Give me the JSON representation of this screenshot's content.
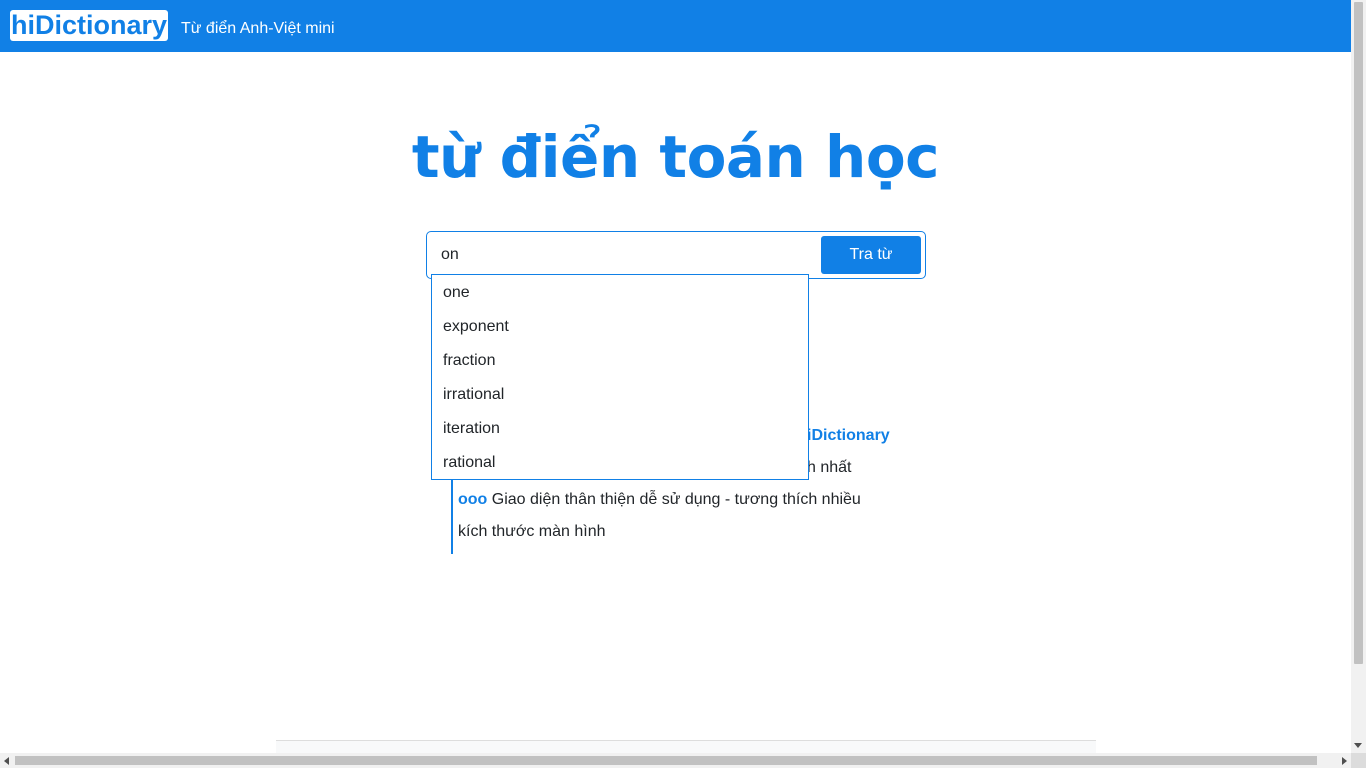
{
  "header": {
    "brand": "hiDictionary",
    "tagline": "Từ điển Anh-Việt mini"
  },
  "main": {
    "title": "từ điển toán học"
  },
  "search": {
    "value": "on",
    "button_label": "Tra từ"
  },
  "suggestions": [
    "one",
    "exponent",
    "fraction",
    "irrational",
    "iteration",
    "rational"
  ],
  "features": {
    "bullet": "ooo",
    "line1_visible": "iDictionary",
    "line2_visible": "h nhất",
    "line3_text": "Giao diện thân thiện dễ sử dụng - tương thích nhiều",
    "line4_text": "kích thước màn hình"
  },
  "colors": {
    "accent": "#1180e6",
    "text": "#212529",
    "background": "#ffffff"
  }
}
